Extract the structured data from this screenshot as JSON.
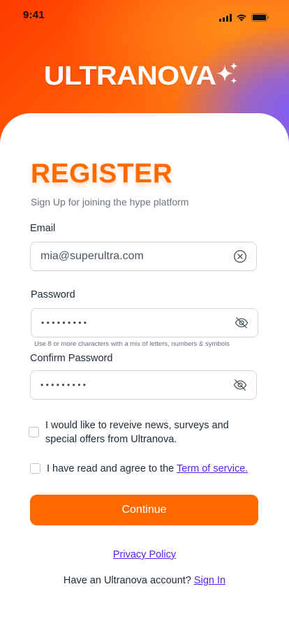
{
  "status_bar": {
    "time": "9:41",
    "icons": [
      "cellular-signal-icon",
      "wifi-icon",
      "battery-icon"
    ]
  },
  "brand": {
    "logo_text": "ULTRANOVA",
    "logo_icon": "sparkle-icon"
  },
  "form": {
    "title": "REGISTER",
    "subtitle": "Sign Up for joining the hype platform",
    "email": {
      "label": "Email",
      "value": "mia@superultra.com",
      "icon": "clear-circle-icon"
    },
    "password": {
      "label": "Password",
      "masked_value": "•••••••••",
      "icon": "eye-off-icon",
      "hint": "Use 8 or more characters with a mix of letters, numbers & symbols"
    },
    "confirm_password": {
      "label": "Confirm Password",
      "masked_value": "•••••••••",
      "icon": "eye-off-icon"
    },
    "newsletter_checkbox": {
      "checked": false,
      "label": "I would like to reveive news, surveys and special offers from Ultranova."
    },
    "terms_checkbox": {
      "checked": false,
      "label_prefix": "I have read and agree to the ",
      "link_text": "Term of service."
    },
    "continue_button": "Continue"
  },
  "footer": {
    "privacy_link": "Privacy Policy",
    "account_prompt": "Have an Ultranova account?",
    "sign_in_link": "Sign In"
  },
  "colors": {
    "accent": "#ff6a00",
    "link": "#5b21f0",
    "gradient_orange": "#ff4a00",
    "gradient_purple": "#7a5cff"
  }
}
